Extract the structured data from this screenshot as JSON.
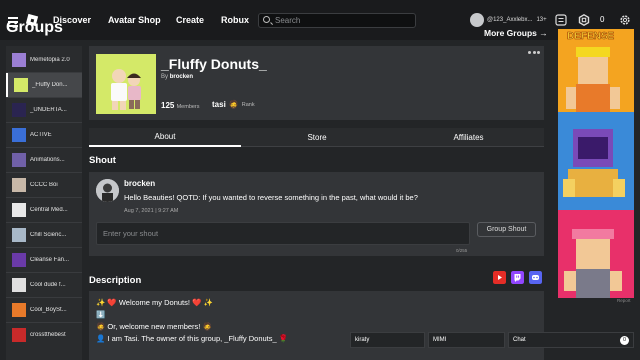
{
  "topbar": {
    "nav": [
      "Discover",
      "Avatar Shop",
      "Create",
      "Robux"
    ],
    "search_placeholder": "Search",
    "username": "@123_Axxlebx...",
    "age": "13+",
    "robux_count": "0"
  },
  "sidebar": {
    "title": "Groups",
    "more_link": "More Groups →",
    "items": [
      {
        "label": "Memetopia 2.0",
        "color": "#9b7fd4"
      },
      {
        "label": "_Fluffy Don...",
        "color": "#d4e968",
        "selected": true
      },
      {
        "label": "_UNDERTA...",
        "color": "#2a2450"
      },
      {
        "label": "ACTIVE",
        "color": "#3a6fd8"
      },
      {
        "label": "Animations...",
        "color": "#7060a8"
      },
      {
        "label": "CCCC Boi",
        "color": "#c8b8a8"
      },
      {
        "label": "Central Med...",
        "color": "#e8e8e8"
      },
      {
        "label": "Chill Scienc...",
        "color": "#a8b8c8"
      },
      {
        "label": "Cleanse Fan...",
        "color": "#6a3aa8"
      },
      {
        "label": "Cool dude f...",
        "color": "#e0e0e0"
      },
      {
        "label": "Cool_BoySt...",
        "color": "#e87a2a"
      },
      {
        "label": "crosstthebest",
        "color": "#c82a2a"
      }
    ]
  },
  "group": {
    "name": "_Fluffy Donuts_",
    "by_prefix": "By",
    "owner": "brocken",
    "members_count": "125",
    "members_label": "Members",
    "rank_name": "tasi",
    "rank_label": "Rank"
  },
  "tabs": [
    "About",
    "Store",
    "Affiliates"
  ],
  "shout": {
    "section_title": "Shout",
    "author": "brocken",
    "message": "Hello Beauties! QOTD: If you wanted to reverse something in the past, what would it be?",
    "date": "Aug 7, 2021 | 9:27 AM",
    "input_placeholder": "Enter your shout",
    "button_label": "Group Shout",
    "char_count": "0/255"
  },
  "description": {
    "section_title": "Description",
    "lines": [
      "✨ ❤️ Welcome my Donuts! ❤️ ✨",
      "⬇️",
      "🧔 Or, welcome new members! 🧔",
      "👤 I am Tasi. The owner of this group, _Fluffy Donuts_ 🌹"
    ]
  },
  "ad": {
    "title": "DEFENSE",
    "report": "Report"
  },
  "chat": [
    {
      "label": "kiraty"
    },
    {
      "label": "MIMI"
    },
    {
      "label": "Chat",
      "count": "0"
    }
  ]
}
